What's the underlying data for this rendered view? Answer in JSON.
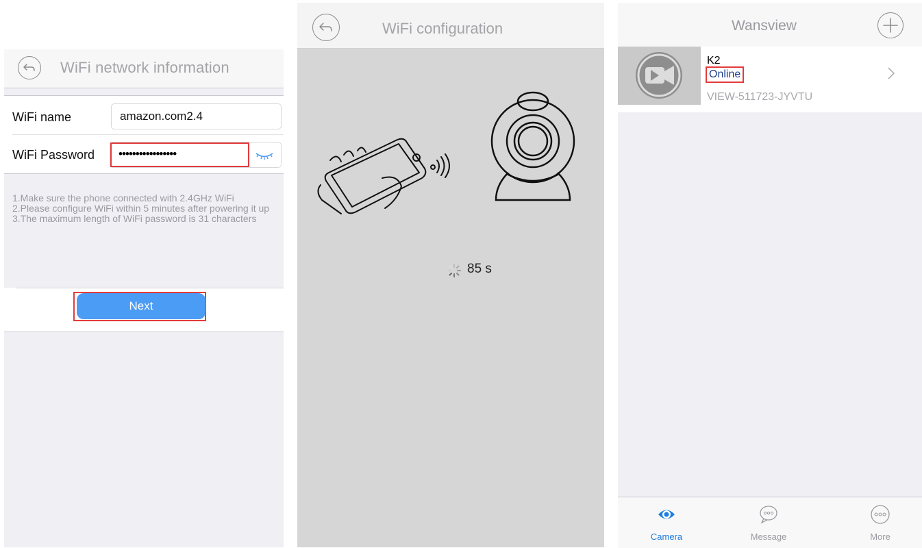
{
  "panel_wifi_info": {
    "title": "WiFi network information",
    "wifi_name_label": "WiFi name",
    "wifi_name_value": "amazon.com2.4",
    "wifi_password_label": "WiFi Password",
    "wifi_password_value": "•••••••••••••••••",
    "notes": [
      "1.Make sure the phone connected with 2.4GHz WiFi",
      "2.Please configure WiFi within 5 minutes after powering it up",
      "3.The maximum length of WiFi password is 31 characters"
    ],
    "next_label": "Next"
  },
  "panel_wifi_config": {
    "title": "WiFi configuration",
    "countdown": "85 s"
  },
  "panel_camera_list": {
    "title": "Wansview",
    "device": {
      "name": "K2",
      "status": "Online",
      "id": "VIEW-511723-JYVTU"
    },
    "tabs": [
      {
        "label": "Camera",
        "icon": "eye-icon"
      },
      {
        "label": "Message",
        "icon": "chat-bubble-icon"
      },
      {
        "label": "More",
        "icon": "more-dots-icon"
      }
    ]
  },
  "colors": {
    "accent": "#4b9cf5",
    "highlight": "#e33b3b",
    "status_text": "#1e3f8a",
    "active_tab": "#1d7de0"
  }
}
